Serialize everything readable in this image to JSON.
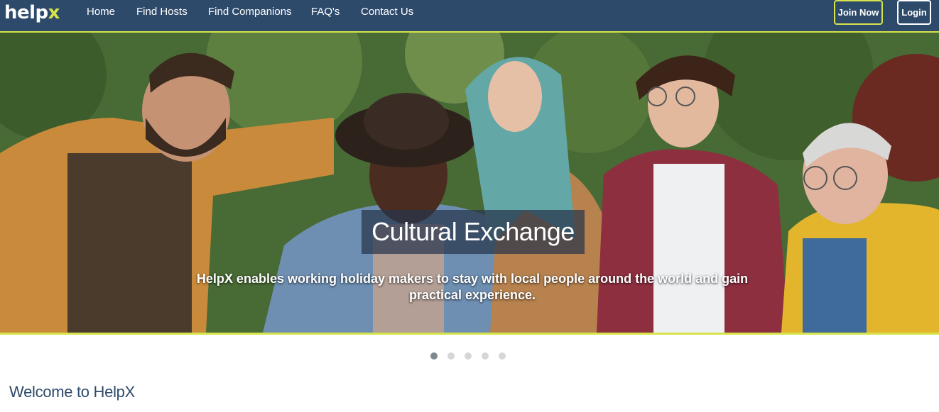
{
  "brand": {
    "logo_main": "help",
    "logo_accent": "x"
  },
  "nav": {
    "links": [
      "Home",
      "Find Hosts",
      "Find Companions",
      "FAQ's",
      "Contact Us"
    ],
    "join_label": "Join Now",
    "login_label": "Login"
  },
  "hero": {
    "title": "Cultural Exchange",
    "subtitle": "HelpX enables working holiday makers to stay with local people around the world and gain practical experience."
  },
  "carousel": {
    "slide_count": 5,
    "active_index": 0
  },
  "main": {
    "heading": "Welcome to HelpX"
  },
  "colors": {
    "nav_bg": "#2e4a6b",
    "accent": "#d7e34a",
    "heading": "#2e4a6b"
  }
}
